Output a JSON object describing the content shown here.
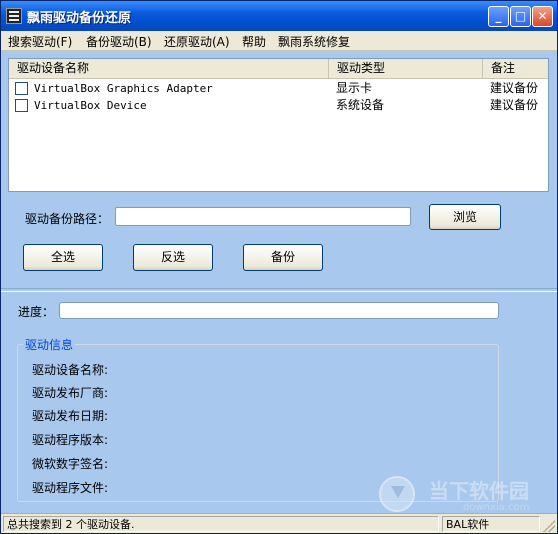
{
  "window": {
    "title": "飘雨驱动备份还原",
    "min_symbol": "_",
    "max_symbol": "□",
    "close_symbol": "✕"
  },
  "menu": {
    "items": [
      "搜索驱动(F)",
      "备份驱动(B)",
      "还原驱动(A)",
      "帮助",
      "飘雨系统修复"
    ]
  },
  "list": {
    "columns": [
      "驱动设备名称",
      "驱动类型",
      "备注"
    ],
    "rows": [
      {
        "checked": false,
        "name": "VirtualBox Graphics Adapter",
        "type": "显示卡",
        "note": "建议备份"
      },
      {
        "checked": false,
        "name": "VirtualBox Device",
        "type": "系统设备",
        "note": "建议备份"
      }
    ]
  },
  "backup": {
    "path_label": "驱动备份路径：",
    "path_value": "",
    "browse_label": "浏览",
    "select_all_label": "全选",
    "invert_label": "反选",
    "backup_label": "备份"
  },
  "progress": {
    "label": "进度：",
    "value": 0
  },
  "info": {
    "title": "驱动信息",
    "labels": [
      "驱动设备名称:",
      "驱动发布厂商:",
      "驱动发布日期:",
      "驱动程序版本:",
      "微软数字签名:",
      "驱动程序文件:"
    ]
  },
  "watermark": {
    "main": "当下软件园",
    "sub": "downxia.com"
  },
  "status": {
    "left": "总共搜索到 2 个驱动设备.",
    "right": "BAL软件"
  },
  "colors": {
    "title_bar": "#0050d0",
    "client_bg": "#a8c8ee",
    "group_title": "#0046d5"
  }
}
